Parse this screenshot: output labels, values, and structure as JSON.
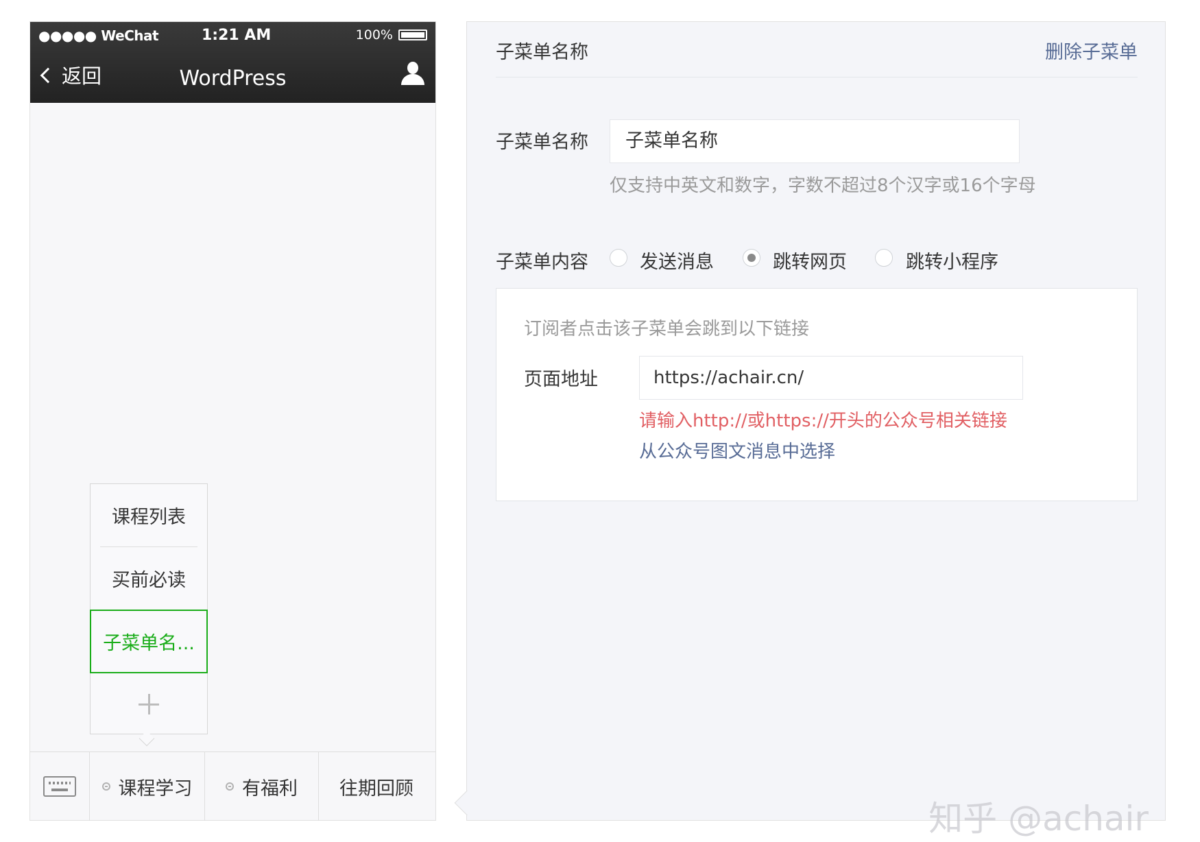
{
  "status_bar": {
    "carrier": "●●●●● WeChat",
    "time": "1:21 AM",
    "battery": "100%"
  },
  "nav": {
    "back_label": "返回",
    "title": "WordPress"
  },
  "submenu": {
    "items": [
      "课程列表",
      "买前必读"
    ],
    "active_item": "子菜单名..."
  },
  "menu_bar": {
    "items": [
      "课程学习",
      "有福利",
      "往期回顾"
    ]
  },
  "panel": {
    "title": "子菜单名称",
    "delete_label": "删除子菜单",
    "name_label": "子菜单名称",
    "name_value": "子菜单名称",
    "name_hint": "仅支持中英文和数字，字数不超过8个汉字或16个字母",
    "content_label": "子菜单内容",
    "options": [
      "发送消息",
      "跳转网页",
      "跳转小程序"
    ],
    "selected_option": "跳转网页",
    "box_hint": "订阅者点击该子菜单会跳到以下链接",
    "url_label": "页面地址",
    "url_value": "https://achair.cn/",
    "url_error": "请输入http://或https://开头的公众号相关链接",
    "pick_link": "从公众号图文消息中选择"
  },
  "watermark": "知乎 @achair",
  "colors": {
    "accent_green": "#1aad19",
    "link_blue": "#576b95",
    "error_red": "#e15f63"
  }
}
